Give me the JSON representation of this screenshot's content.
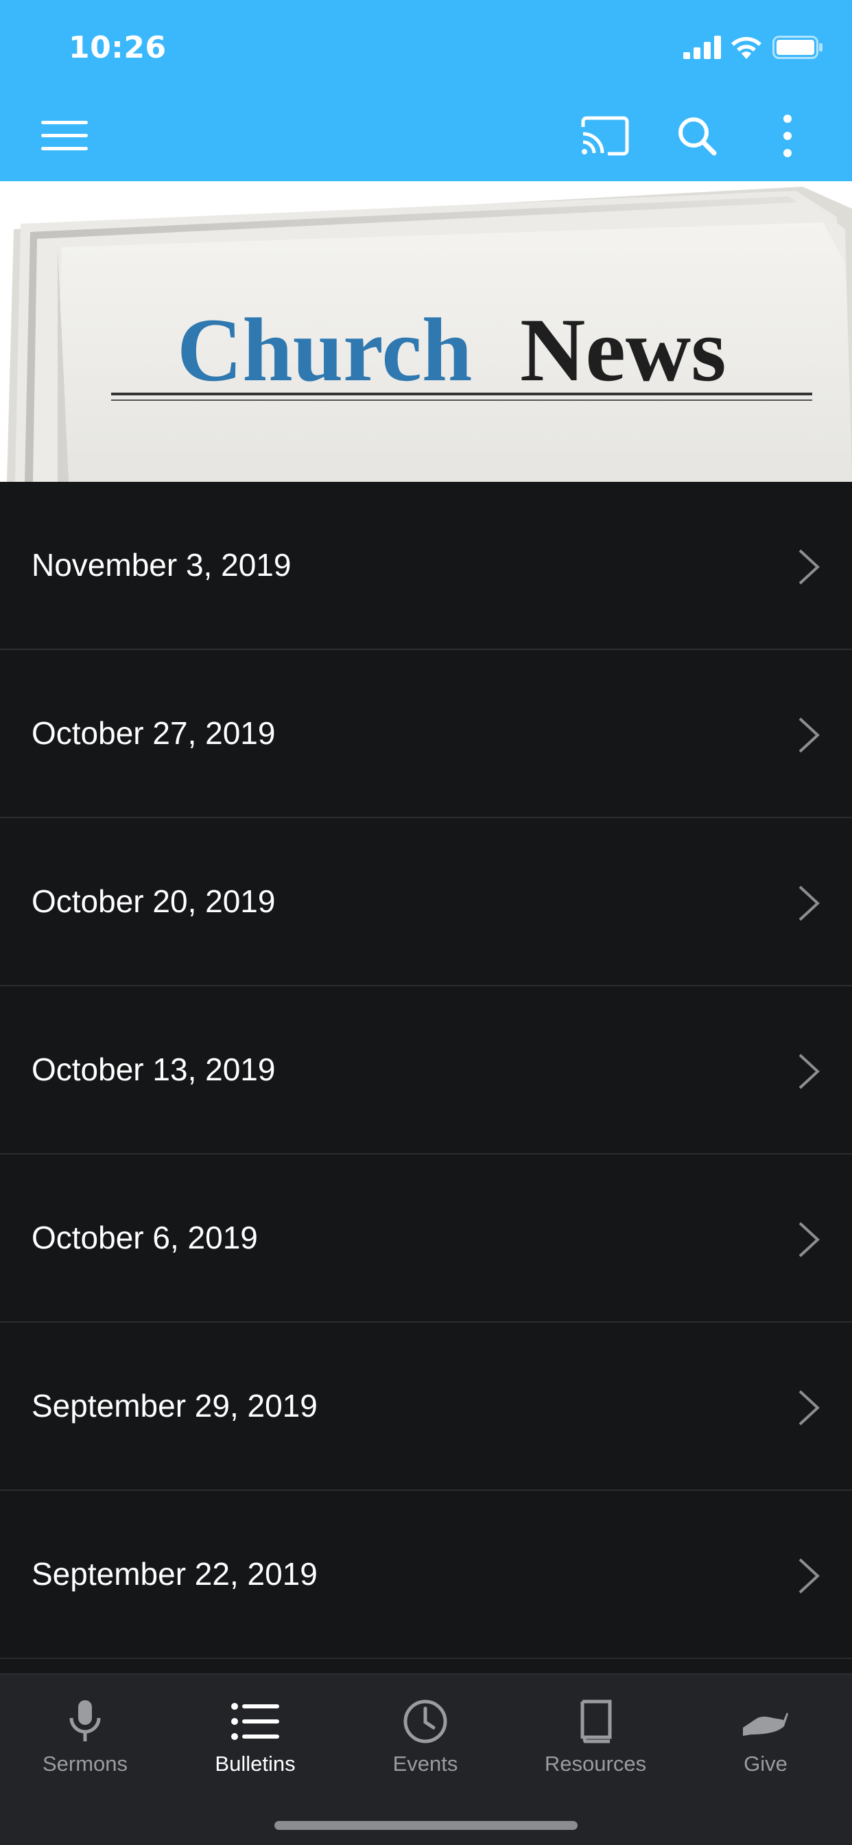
{
  "status_bar": {
    "time": "10:26"
  },
  "banner": {
    "title_word1": "Church",
    "title_word2": "News"
  },
  "bulletins": [
    {
      "label": "November 3, 2019"
    },
    {
      "label": "October 27, 2019"
    },
    {
      "label": "October 20, 2019"
    },
    {
      "label": "October 13, 2019"
    },
    {
      "label": "October 6, 2019"
    },
    {
      "label": "September 29, 2019"
    },
    {
      "label": "September 22, 2019"
    }
  ],
  "tabs": [
    {
      "label": "Sermons",
      "icon": "microphone-icon"
    },
    {
      "label": "Bulletins",
      "icon": "list-icon",
      "active": true
    },
    {
      "label": "Events",
      "icon": "clock-icon"
    },
    {
      "label": "Resources",
      "icon": "book-icon"
    },
    {
      "label": "Give",
      "icon": "give-hand-icon"
    }
  ],
  "colors": {
    "appbar": "#3ab8fb",
    "list_bg": "#151618",
    "tabbar_bg": "#232427",
    "active_tab": "#ffffff",
    "inactive_tab": "#9b9ca0",
    "headline_blue": "#2f78b0"
  }
}
